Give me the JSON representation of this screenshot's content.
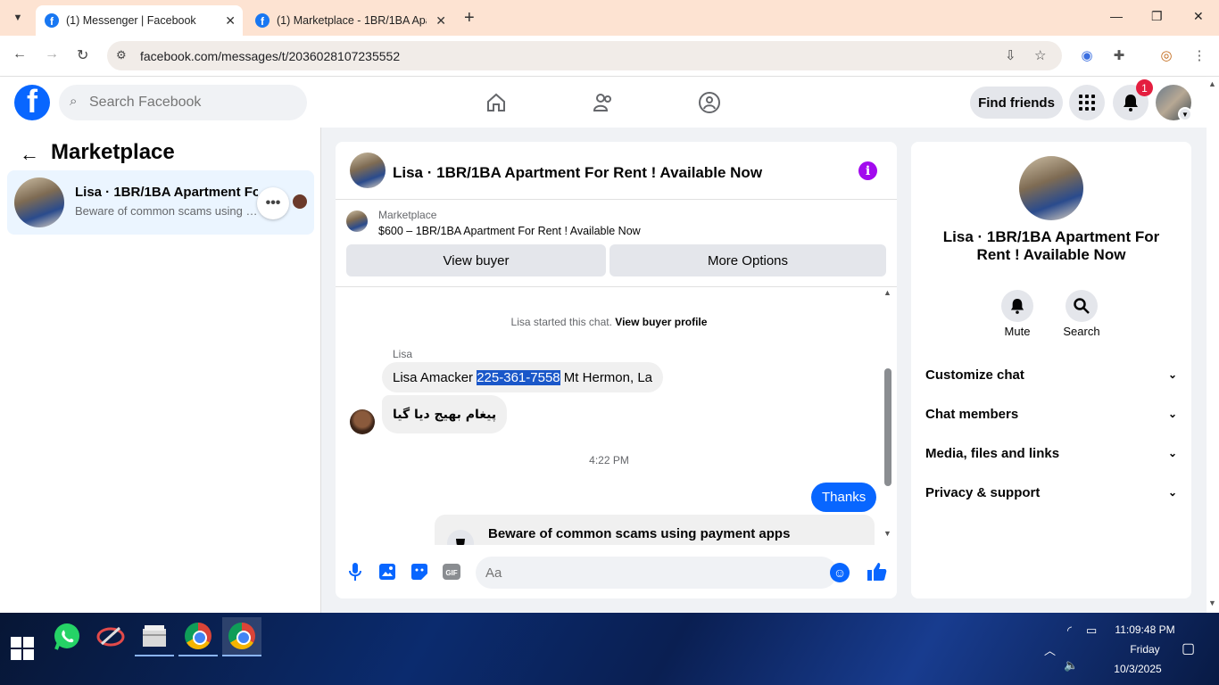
{
  "browser": {
    "tabs": [
      {
        "title": "(1) Messenger | Facebook",
        "active": true
      },
      {
        "title": "(1) Marketplace - 1BR/1BA Apartment For Rent",
        "active": false
      }
    ],
    "url": "facebook.com/messages/t/2036028107235552"
  },
  "fb_header": {
    "search_placeholder": "Search Facebook",
    "find_friends_label": "Find friends",
    "notification_count": "1"
  },
  "sidebar": {
    "title": "Marketplace",
    "conversation": {
      "name": "Lisa · 1BR/1BA Apartment For Rent ! Available Now",
      "preview": "Beware of common scams using payment apps"
    }
  },
  "chat": {
    "title": "Lisa · 1BR/1BA Apartment For Rent ! Available Now",
    "listing_label": "Marketplace",
    "listing_price_title": "$600 – 1BR/1BA Apartment For Rent ! Available Now",
    "view_buyer_label": "View buyer",
    "more_options_label": "More Options",
    "started_text": "Lisa started this chat.",
    "view_buyer_profile_label": "View buyer profile",
    "sender_name": "Lisa",
    "messages": {
      "msg1_prefix": "Lisa Amacker ",
      "msg1_highlight": "225-361-7558",
      "msg1_suffix": " Mt Hermon, La",
      "msg2": "پیغام بھیج دیا گیا"
    },
    "timestamp": "4:22 PM",
    "outgoing_message": "Thanks",
    "scam_notice": "Beware of common scams using payment apps",
    "composer_placeholder": "Aa"
  },
  "info_panel": {
    "name": "Lisa · 1BR/1BA Apartment For Rent ! Available Now",
    "mute_label": "Mute",
    "search_label": "Search",
    "sections": [
      "Customize chat",
      "Chat members",
      "Media, files and links",
      "Privacy & support"
    ]
  },
  "taskbar": {
    "time": "11:09:48 PM",
    "day": "Friday",
    "date": "10/3/2025"
  }
}
